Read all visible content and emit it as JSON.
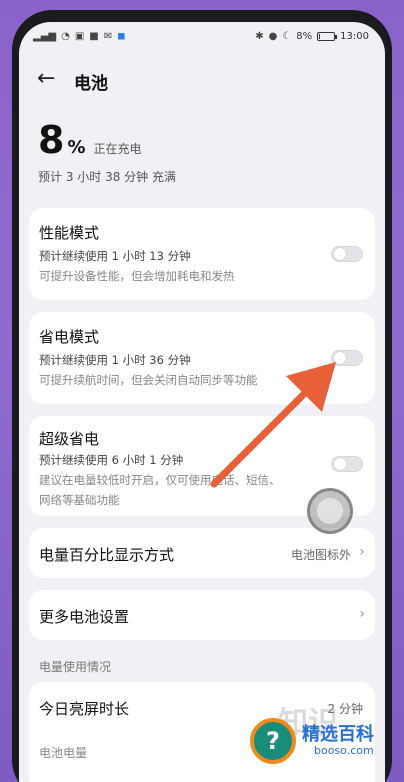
{
  "status_bar": {
    "time": "13:00",
    "battery_text": "8%",
    "battery_level": 0.08
  },
  "header": {
    "back_glyph": "←",
    "title": "电池"
  },
  "battery_summary": {
    "percent": "8",
    "percent_sign": "%",
    "state": "正在充电",
    "estimate": "预计 3 小时 38 分钟 充满"
  },
  "modes": [
    {
      "title": "性能模式",
      "line1": "预计继续使用 1 小时 13 分钟",
      "line2": "可提升设备性能，但会增加耗电和发热",
      "enabled": false
    },
    {
      "title": "省电模式",
      "line1": "预计继续使用 1 小时 36 分钟",
      "line2": "可提升续航时间，但会关闭自动同步等功能",
      "enabled": false
    },
    {
      "title": "超级省电",
      "line1": "预计继续使用 6 小时 1 分钟",
      "line2": "建议在电量较低时开启，仅可使用电话、短信、",
      "line3": "网络等基础功能",
      "enabled": false
    }
  ],
  "rows": {
    "percentage_display": {
      "label": "电量百分比显示方式",
      "value": "电池图标外"
    },
    "more_settings": {
      "label": "更多电池设置"
    }
  },
  "usage": {
    "section_label": "电量使用情况",
    "screen_on_label": "今日亮屏时长",
    "screen_on_value": "2 分钟",
    "battery_level_label": "电池电量"
  },
  "watermark": {
    "mark": "?",
    "text": "精选百科",
    "sub": "booso.com",
    "bg_text": "知识"
  },
  "colors": {
    "annotation_arrow": "#e8603a",
    "background_purple": "#8a63c9"
  }
}
